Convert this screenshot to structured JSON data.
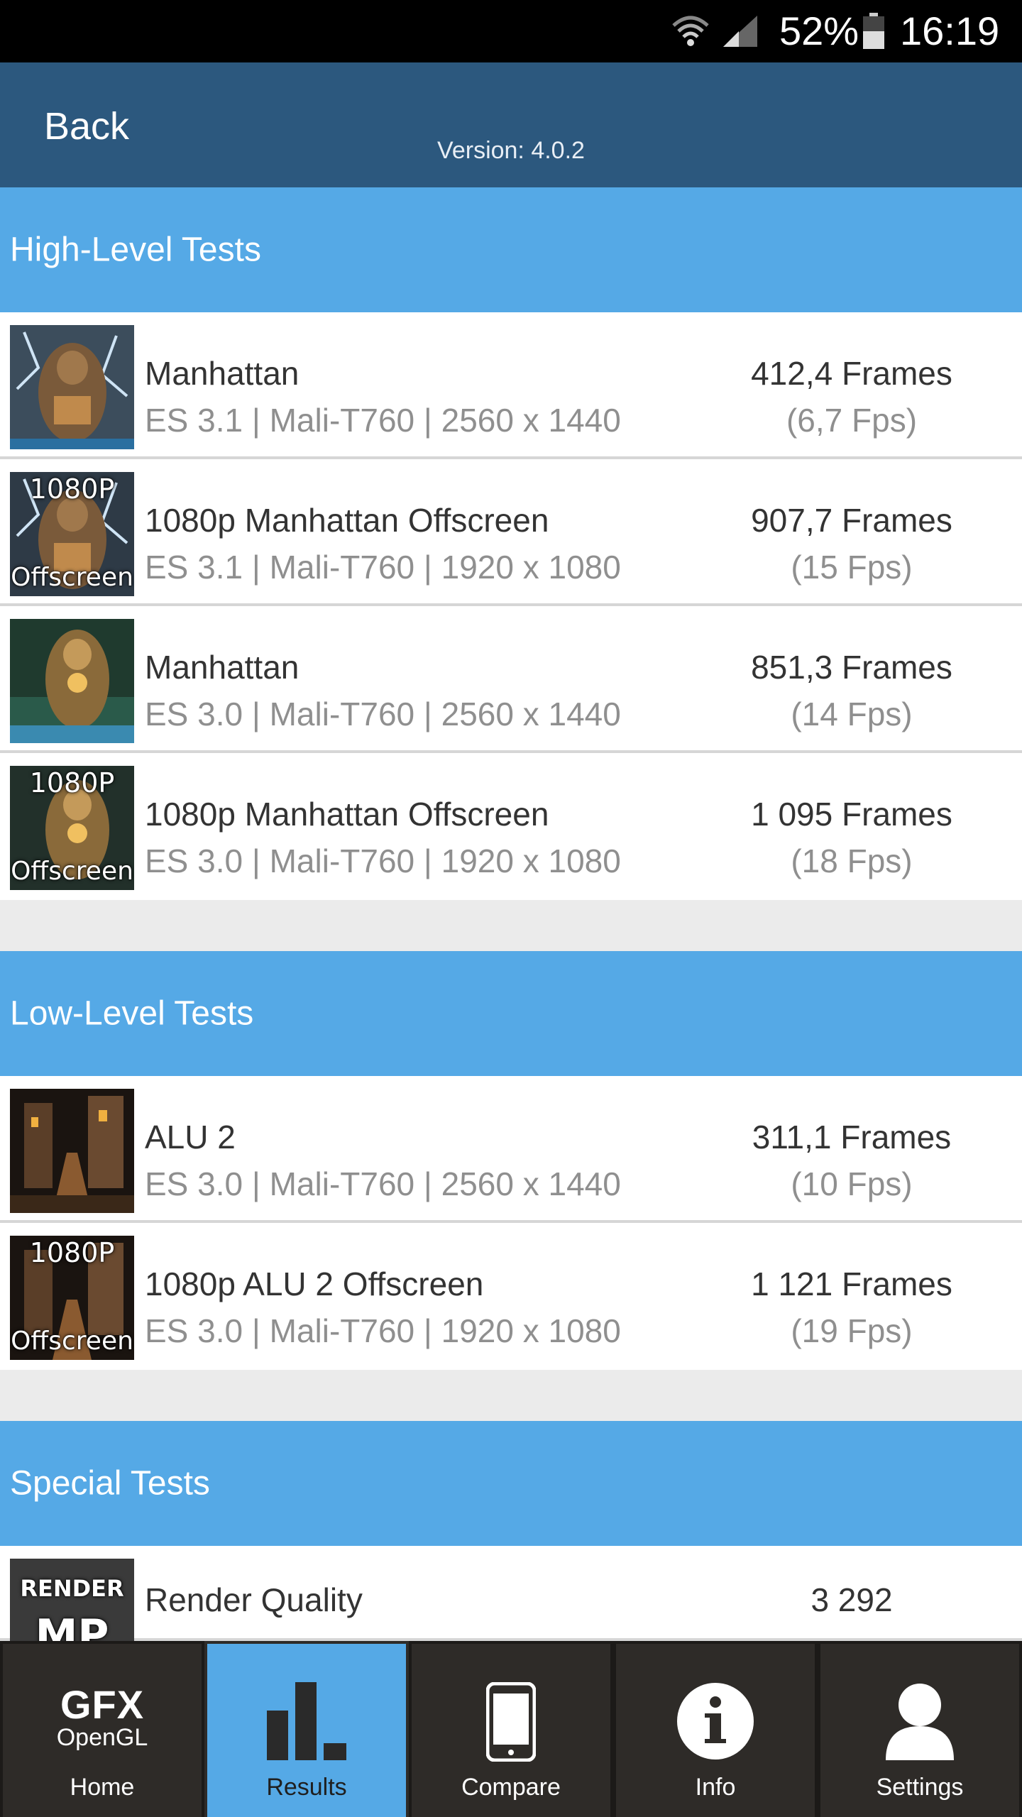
{
  "status_bar": {
    "battery_pct": "52%",
    "time": "16:19"
  },
  "header": {
    "back_label": "Back",
    "version": "Version: 4.0.2"
  },
  "sections": {
    "high_level": {
      "title": "High-Level Tests",
      "rows": [
        {
          "title": "Manhattan",
          "sub": "ES 3.1 | Mali-T760 | 2560 x 1440",
          "score": "412,4 Frames",
          "fps": "(6,7 Fps)"
        },
        {
          "title": "1080p Manhattan Offscreen",
          "sub": "ES 3.1 | Mali-T760 | 1920 x 1080",
          "score": "907,7 Frames",
          "fps": "(15 Fps)",
          "badge_top": "1080P",
          "badge_bottom": "Offscreen"
        },
        {
          "title": "Manhattan",
          "sub": "ES 3.0 | Mali-T760 | 2560 x 1440",
          "score": "851,3 Frames",
          "fps": "(14 Fps)"
        },
        {
          "title": "1080p Manhattan Offscreen",
          "sub": "ES 3.0 | Mali-T760 | 1920 x 1080",
          "score": "1 095 Frames",
          "fps": "(18 Fps)",
          "badge_top": "1080P",
          "badge_bottom": "Offscreen"
        }
      ]
    },
    "low_level": {
      "title": "Low-Level Tests",
      "rows": [
        {
          "title": "ALU 2",
          "sub": "ES 3.0 | Mali-T760 | 2560 x 1440",
          "score": "311,1 Frames",
          "fps": "(10 Fps)"
        },
        {
          "title": "1080p ALU 2 Offscreen",
          "sub": "ES 3.0 | Mali-T760 | 1920 x 1080",
          "score": "1 121 Frames",
          "fps": "(19 Fps)",
          "badge_top": "1080P",
          "badge_bottom": "Offscreen"
        }
      ]
    },
    "special": {
      "title": "Special Tests",
      "rows": [
        {
          "title": "Render Quality",
          "score": "3 292",
          "badge_top": "RENDER",
          "badge_bottom": "MP"
        }
      ]
    }
  },
  "bottom_nav": {
    "logo_main": "GFX",
    "logo_sub": "OpenGL",
    "items": [
      {
        "label": "Home",
        "icon": "gfx-logo"
      },
      {
        "label": "Results",
        "icon": "bar-chart-icon"
      },
      {
        "label": "Compare",
        "icon": "phone-icon"
      },
      {
        "label": "Info",
        "icon": "info-icon"
      },
      {
        "label": "Settings",
        "icon": "user-icon"
      }
    ],
    "active": "Results"
  },
  "colors": {
    "header": "#2c587e",
    "section": "#55a9e6",
    "nav_bg": "#2e2b28"
  }
}
